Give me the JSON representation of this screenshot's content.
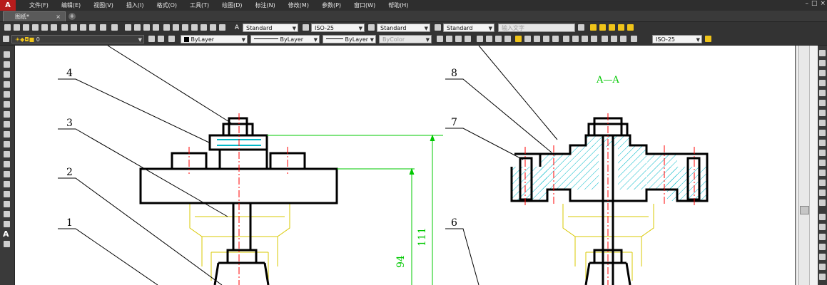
{
  "app": {
    "logo": "A",
    "window_controls": [
      "–",
      "□",
      "×"
    ]
  },
  "menu": [
    "文件(F)",
    "编辑(E)",
    "视图(V)",
    "插入(I)",
    "格式(O)",
    "工具(T)",
    "绘图(D)",
    "标注(N)",
    "修改(M)",
    "参数(P)",
    "窗口(W)",
    "帮助(H)"
  ],
  "tabs": [
    {
      "label": "图纸*",
      "close": "×"
    }
  ],
  "add_tab": "+",
  "toolbar": {
    "text_style": "Standard",
    "dim_style": "ISO-25",
    "table_style": "Standard",
    "mleader_style": "Standard",
    "search_placeholder": "输入文字",
    "layer": "0",
    "color": "ByLayer",
    "linetype": "ByLayer",
    "lineweight": "ByLayer",
    "plotstyle": "ByColor",
    "dim_style_2": "ISO-25"
  },
  "drawing": {
    "section_title": "A—A",
    "balloons": [
      "4",
      "3",
      "2",
      "1",
      "8",
      "7",
      "6"
    ],
    "dimensions": [
      "111",
      "94"
    ]
  },
  "colors": {
    "accent_green": "#00c800",
    "outline": "#000000",
    "hatch": "#00b8c8",
    "center": "#ff0000",
    "hidden": "#d9c800"
  }
}
